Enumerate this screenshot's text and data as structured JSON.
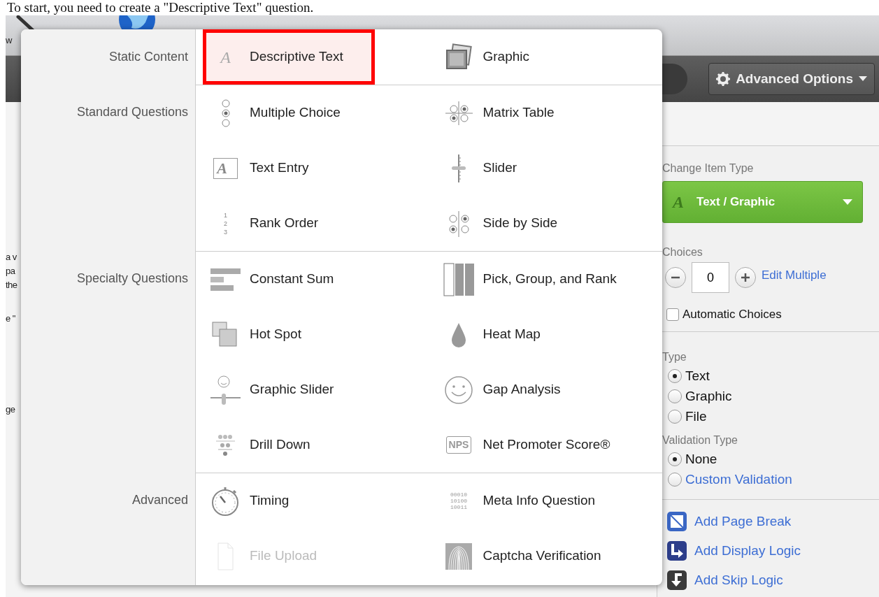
{
  "caption": "To start, you need to create a \"Descriptive Text\" question.",
  "toolbar": {
    "advanced_options": "Advanced Options"
  },
  "background_fragments": [
    "w",
    "a v",
    "pa",
    "the",
    "e \"",
    "ge"
  ],
  "menu": {
    "sections": [
      {
        "label": "Static Content",
        "items": [
          {
            "label": "Descriptive Text",
            "glyph": "A",
            "selected": true,
            "disabled": false
          },
          {
            "label": "Graphic",
            "selected": false,
            "disabled": false
          }
        ]
      },
      {
        "label": "Standard Questions",
        "items": [
          {
            "label": "Multiple Choice",
            "selected": false,
            "disabled": false
          },
          {
            "label": "Matrix Table",
            "selected": false,
            "disabled": false
          },
          {
            "label": "Text Entry",
            "glyph": "A",
            "selected": false,
            "disabled": false
          },
          {
            "label": "Slider",
            "selected": false,
            "disabled": false
          },
          {
            "label": "Rank Order",
            "glyph": "1\n2\n3",
            "selected": false,
            "disabled": false
          },
          {
            "label": "Side by Side",
            "selected": false,
            "disabled": false
          }
        ]
      },
      {
        "label": "Specialty Questions",
        "items": [
          {
            "label": "Constant Sum",
            "selected": false,
            "disabled": false
          },
          {
            "label": "Pick, Group, and Rank",
            "selected": false,
            "disabled": false
          },
          {
            "label": "Hot Spot",
            "selected": false,
            "disabled": false
          },
          {
            "label": "Heat Map",
            "selected": false,
            "disabled": false
          },
          {
            "label": "Graphic Slider",
            "selected": false,
            "disabled": false
          },
          {
            "label": "Gap Analysis",
            "selected": false,
            "disabled": false
          },
          {
            "label": "Drill Down",
            "selected": false,
            "disabled": false
          },
          {
            "label": "Net Promoter Score®",
            "glyph": "NPS",
            "selected": false,
            "disabled": false
          }
        ]
      },
      {
        "label": "Advanced",
        "items": [
          {
            "label": "Timing",
            "selected": false,
            "disabled": false
          },
          {
            "label": "Meta Info Question",
            "glyph": "00010\n10100\n10011",
            "selected": false,
            "disabled": false
          },
          {
            "label": "File Upload",
            "selected": false,
            "disabled": true
          },
          {
            "label": "Captcha Verification",
            "selected": false,
            "disabled": false
          }
        ]
      }
    ]
  },
  "panel": {
    "change_item_type": {
      "label": "Change Item Type",
      "glyph": "A",
      "value": "Text / Graphic"
    },
    "choices": {
      "label": "Choices",
      "count": "0",
      "link": "Edit Multiple",
      "automatic": {
        "label": "Automatic Choices",
        "checked": false
      }
    },
    "type": {
      "label": "Type",
      "options": [
        {
          "label": "Text",
          "selected": true,
          "kind": "plain"
        },
        {
          "label": "Graphic",
          "selected": false,
          "kind": "plain"
        },
        {
          "label": "File",
          "selected": false,
          "kind": "plain"
        }
      ]
    },
    "validation": {
      "label": "Validation Type",
      "options": [
        {
          "label": "None",
          "selected": true,
          "kind": "plain"
        },
        {
          "label": "Custom Validation",
          "selected": false,
          "kind": "link"
        }
      ]
    },
    "actions": [
      {
        "label": "Add Page Break"
      },
      {
        "label": "Add Display Logic"
      },
      {
        "label": "Add Skip Logic"
      }
    ]
  }
}
